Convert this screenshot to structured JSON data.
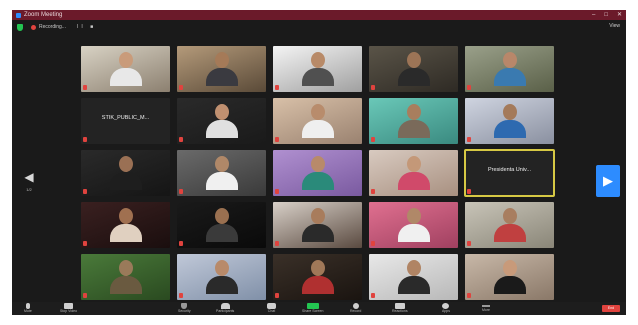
{
  "window": {
    "title": "Zoom Meeting"
  },
  "topbar": {
    "recording": "Recording...",
    "recording_controls": "II ■",
    "view_label": "View"
  },
  "pager": {
    "left_page": "1/2",
    "left_arrow": "◀",
    "right_arrow": "▶"
  },
  "colors": {
    "accent": "#2d8cff",
    "share_green": "#23c552",
    "end_red": "#e0433e",
    "active_border": "#d6c844",
    "titlebar": "#6b1a2a"
  },
  "participants": [
    {
      "name": "",
      "video": true,
      "c1": "#d8d2c4",
      "c2": "#8c8070",
      "skin": "#c99b7a",
      "shirt": "#e8e8e8"
    },
    {
      "name": "",
      "video": true,
      "c1": "#b49a7a",
      "c2": "#5a4a38",
      "skin": "#a57a58",
      "shirt": "#3a3a40"
    },
    {
      "name": "",
      "video": true,
      "c1": "#f4f4f4",
      "c2": "#a0a0a0",
      "skin": "#b88a68",
      "shirt": "#505050"
    },
    {
      "name": "",
      "video": true,
      "c1": "#5a5448",
      "c2": "#2e2a24",
      "skin": "#9c7456",
      "shirt": "#2a2a2a"
    },
    {
      "name": "",
      "video": true,
      "c1": "#9aa08a",
      "c2": "#5a6048",
      "skin": "#b8876a",
      "shirt": "#3a7ab0"
    },
    {
      "name": "",
      "video": false,
      "center": "STIK_PUBLIC_M..."
    },
    {
      "name": "",
      "video": true,
      "c1": "#2a2a2a",
      "c2": "#1a1a1a",
      "skin": "#c09070",
      "shirt": "#e0e0e0"
    },
    {
      "name": "",
      "video": true,
      "c1": "#d8c0a8",
      "c2": "#9a8270",
      "skin": "#b88c6c",
      "shirt": "#efefef"
    },
    {
      "name": "",
      "video": true,
      "c1": "#6ac8b8",
      "c2": "#3a8a80",
      "skin": "#a87e5e",
      "shirt": "#7a6a5a"
    },
    {
      "name": "",
      "video": true,
      "c1": "#cfd4e0",
      "c2": "#8a90a0",
      "skin": "#a47a5a",
      "shirt": "#2e6ab0"
    },
    {
      "name": "",
      "video": true,
      "c1": "#2a2a2a",
      "c2": "#151515",
      "skin": "#9a7054",
      "shirt": "#1e1e1e"
    },
    {
      "name": "",
      "video": true,
      "c1": "#6a6a6a",
      "c2": "#3a3a3a",
      "skin": "#b08868",
      "shirt": "#f0f0f0"
    },
    {
      "name": "",
      "video": true,
      "c1": "#b090d0",
      "c2": "#7a5aa0",
      "skin": "#b88a6a",
      "shirt": "#2a8a7a"
    },
    {
      "name": "",
      "video": true,
      "c1": "#d8cac0",
      "c2": "#a89080",
      "skin": "#c49878",
      "shirt": "#d04a6a"
    },
    {
      "name": "",
      "video": false,
      "center": "Presidenta Univ...",
      "active": true
    },
    {
      "name": "",
      "video": true,
      "c1": "#3a2020",
      "c2": "#1a0e0e",
      "skin": "#a07050",
      "shirt": "#e0d0c0"
    },
    {
      "name": "",
      "video": true,
      "c1": "#1a1a1a",
      "c2": "#0a0a0a",
      "skin": "#9a7050",
      "shirt": "#3a3a3a"
    },
    {
      "name": "",
      "video": true,
      "c1": "#d8d0c8",
      "c2": "#5a4a40",
      "skin": "#a87c5c",
      "shirt": "#2a2a2a"
    },
    {
      "name": "",
      "video": true,
      "c1": "#e07090",
      "c2": "#a04060",
      "skin": "#b08868",
      "shirt": "#f0f0f0"
    },
    {
      "name": "",
      "video": true,
      "c1": "#c8c4b8",
      "c2": "#8a8678",
      "skin": "#a87e60",
      "shirt": "#c04040"
    },
    {
      "name": "",
      "video": true,
      "c1": "#4a7a3a",
      "c2": "#2a4a20",
      "skin": "#9a7a5a",
      "shirt": "#6a5a40"
    },
    {
      "name": "",
      "video": true,
      "c1": "#c0c8d8",
      "c2": "#8090a8",
      "skin": "#b88a6a",
      "shirt": "#2a2a2a"
    },
    {
      "name": "",
      "video": true,
      "c1": "#3a3028",
      "c2": "#1a1410",
      "skin": "#a07858",
      "shirt": "#b03030"
    },
    {
      "name": "",
      "video": true,
      "c1": "#e8e8e8",
      "c2": "#b8b8b8",
      "skin": "#b08464",
      "shirt": "#2a2a2a"
    },
    {
      "name": "",
      "video": true,
      "c1": "#c8b8a8",
      "c2": "#8a7868",
      "skin": "#c89a7a",
      "shirt": "#1a1a1a"
    }
  ],
  "toolbar": {
    "mute": "Mute",
    "video": "Stop Video",
    "security": "Security",
    "participants": "Participants",
    "chat": "Chat",
    "share": "Share Screen",
    "record": "Record",
    "generate": "Reactions",
    "apps": "Apps",
    "more": "More",
    "end": "End"
  }
}
